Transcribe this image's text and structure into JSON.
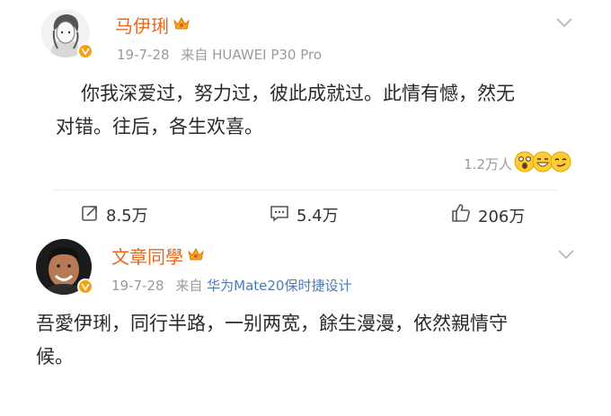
{
  "post1": {
    "name": "马伊琍",
    "date": "19-7-28",
    "source_prefix": "来自",
    "source": "HUAWEI P30 Pro",
    "content_line1": "你我深爱过，努力过，彼此成就过。此情有憾，然无",
    "content_line2": "对错。往后，各生欢喜。",
    "reaction_count": "1.2万人",
    "reactions": [
      "shocked-emoji",
      "grin-emoji",
      "smirk-emoji"
    ],
    "actions": {
      "repost": "8.5万",
      "comment": "5.4万",
      "like": "206万"
    }
  },
  "post2": {
    "name": "文章同學",
    "date": "19-7-28",
    "source_prefix": "来自",
    "source": "华为Mate20保时捷设计",
    "content_line1": "吾愛伊琍，同行半路，一别两宽，餘生漫漫，依然親情守",
    "content_line2": "候。"
  },
  "colors": {
    "name": "#e8671c",
    "meta": "#9a9a9a",
    "link": "#4d7bb3",
    "badge": "#f6a10c",
    "text": "#2a2a2a"
  }
}
